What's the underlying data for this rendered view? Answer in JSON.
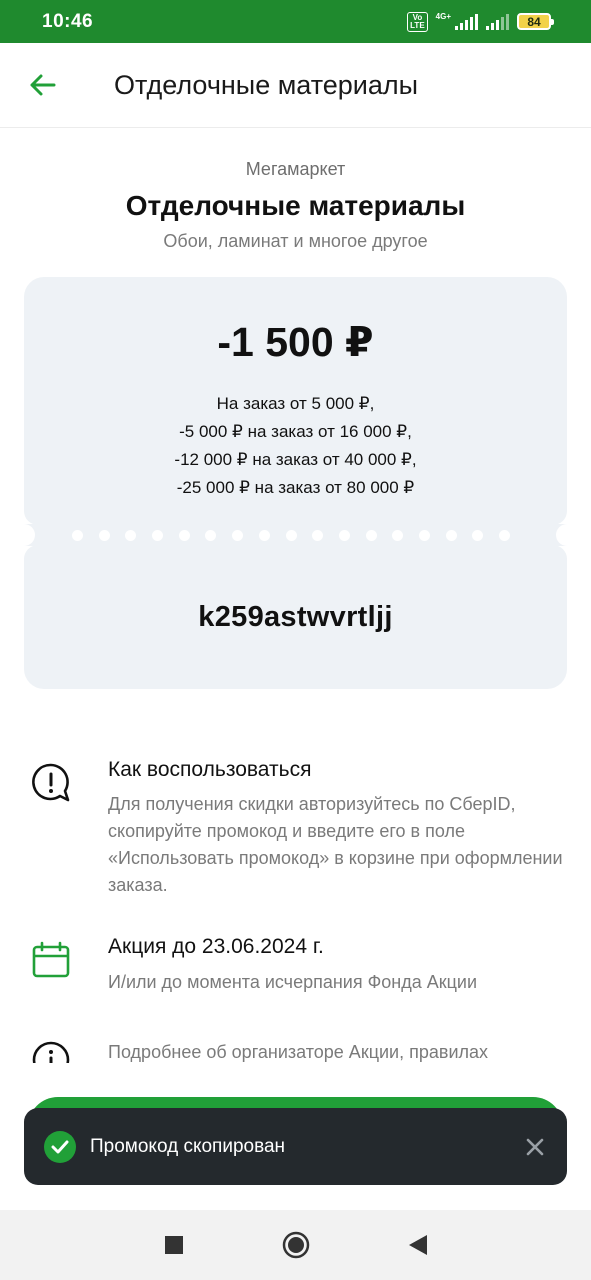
{
  "status_bar": {
    "time": "10:46",
    "volte_line1": "Vo",
    "volte_line2": "LTE",
    "network": "4G+",
    "battery": "84"
  },
  "app_bar": {
    "title": "Отделочные материалы",
    "back_icon": "arrow-left-icon"
  },
  "offer": {
    "brand": "Мегамаркет",
    "title": "Отделочные материалы",
    "subtitle": "Обои, ламинат и многое другое",
    "discount": "-1 500 ₽",
    "conditions": [
      "На заказ от 5 000 ₽,",
      "-5 000 ₽ на заказ от 16 000 ₽,",
      "-12 000 ₽ на заказ от 40 000 ₽,",
      "-25 000 ₽ на заказ от 80 000 ₽"
    ],
    "promo_code": "k259astwvrtljj"
  },
  "info": {
    "how_to": {
      "icon": "alert-bubble-icon",
      "heading": "Как воспользоваться",
      "text": "Для получения скидки авторизуйтесь по СберID, скопируйте промокод и введите его в поле «Использовать промокод» в корзине при оформлении заказа."
    },
    "validity": {
      "icon": "calendar-icon",
      "heading": "Акция до 23.06.2024 г.",
      "text": "И/или до момента исчерпания Фонда Акции"
    },
    "organizer": {
      "icon": "info-icon",
      "text": "Подробнее об организаторе Акции, правилах"
    }
  },
  "toast": {
    "text": "Промокод скопирован",
    "check_icon": "check-circle-icon",
    "close_icon": "close-icon"
  },
  "colors": {
    "brand_green": "#21a038",
    "status_green": "#1f8a2e",
    "card_bg": "#eef2f6",
    "toast_bg": "#24292d"
  }
}
